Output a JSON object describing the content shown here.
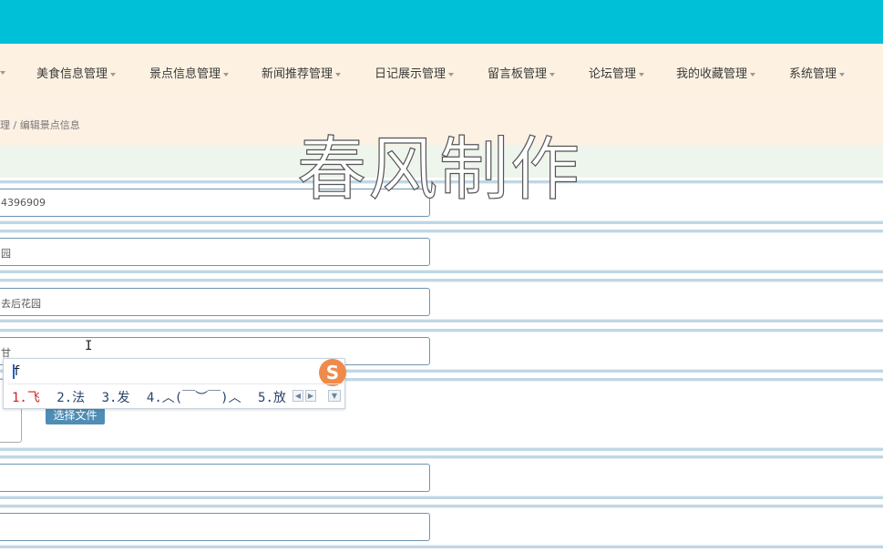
{
  "nav": {
    "items": [
      {
        "label": "美食信息管理"
      },
      {
        "label": "景点信息管理"
      },
      {
        "label": "新闻推荐管理"
      },
      {
        "label": "日记展示管理"
      },
      {
        "label": "留言板管理"
      },
      {
        "label": "论坛管理"
      },
      {
        "label": "我的收藏管理"
      },
      {
        "label": "系统管理"
      }
    ]
  },
  "breadcrumb": {
    "text": "理 / 编辑景点信息"
  },
  "watermark": {
    "text": "春风制作"
  },
  "form": {
    "fields": [
      {
        "value": "4396909"
      },
      {
        "value": "园"
      },
      {
        "value": "去后花园"
      },
      {
        "value": "甘"
      }
    ],
    "upload_button": "选择文件"
  },
  "ime": {
    "input": "f",
    "logo": "S",
    "candidates": [
      "1.飞",
      "2.法",
      "3.发",
      "4.︿(￣︶￣)︿",
      "5.放"
    ]
  },
  "colors": {
    "topbar": "#00c0d8",
    "navbar": "#fdf2e2",
    "upload_button": "#4f8db5",
    "ime_first_candidate": "#d42222"
  }
}
